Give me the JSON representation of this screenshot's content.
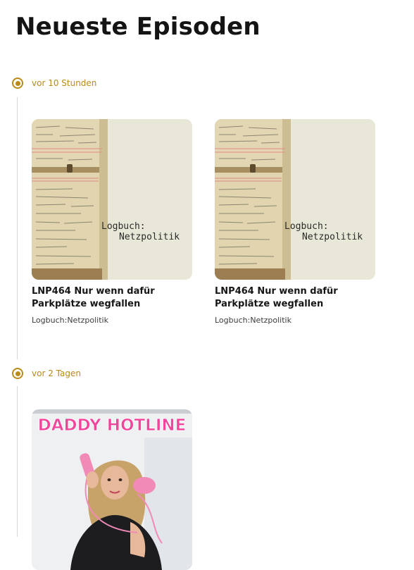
{
  "page": {
    "title": "Neueste Episoden"
  },
  "groups": [
    {
      "label": "vor 10 Stunden",
      "episodes": [
        {
          "title": "LNP464 Nur wenn dafür Parkplätze wegfallen",
          "podcast": "Logbuch:Netzpolitik",
          "cover": {
            "line1": "Logbuch:",
            "line2": "Netzpolitik"
          }
        },
        {
          "title": "LNP464 Nur wenn dafür Parkplätze wegfallen",
          "podcast": "Logbuch:Netzpolitik",
          "cover": {
            "line1": "Logbuch:",
            "line2": "Netzpolitik"
          }
        }
      ]
    },
    {
      "label": "vor 2 Tagen",
      "episodes": [
        {
          "cover": {
            "line1": "DADDY HOTLINE"
          }
        }
      ]
    }
  ],
  "colors": {
    "accent": "#b98a15",
    "title": "#141414",
    "timeline": "#d6d6d6",
    "hotline_pink": "#f0459a"
  }
}
